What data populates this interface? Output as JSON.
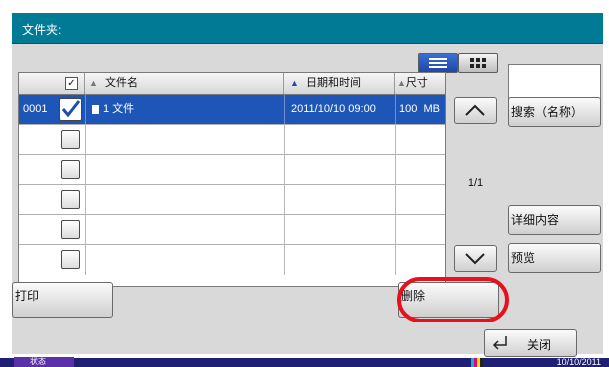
{
  "title": "文件夹:",
  "columns": {
    "name": "文件名",
    "datetime": "日期和时间",
    "size": "尺寸"
  },
  "rows": [
    {
      "number": "0001",
      "checked": true,
      "name": "1 文件",
      "datetime": "2011/10/10 09:00",
      "size": "100  MB"
    },
    {
      "number": "",
      "checked": false,
      "name": "",
      "datetime": "",
      "size": ""
    },
    {
      "number": "",
      "checked": false,
      "name": "",
      "datetime": "",
      "size": ""
    },
    {
      "number": "",
      "checked": false,
      "name": "",
      "datetime": "",
      "size": ""
    },
    {
      "number": "",
      "checked": false,
      "name": "",
      "datetime": "",
      "size": ""
    },
    {
      "number": "",
      "checked": false,
      "name": "",
      "datetime": "",
      "size": ""
    }
  ],
  "pagination": {
    "indicator": "1/1"
  },
  "side_buttons": {
    "search": "搜索（名称）",
    "details": "详细内容",
    "preview": "预览"
  },
  "actions": {
    "print": "打印",
    "delete": "删除",
    "close": "关闭"
  },
  "status": {
    "label": "状态",
    "date": "10/10/2011"
  },
  "colors": {
    "title_bar": "#007a95",
    "selected_row": "#1e56b8",
    "highlight_ring": "#e8101c",
    "status_bar": "#1f1f73"
  }
}
